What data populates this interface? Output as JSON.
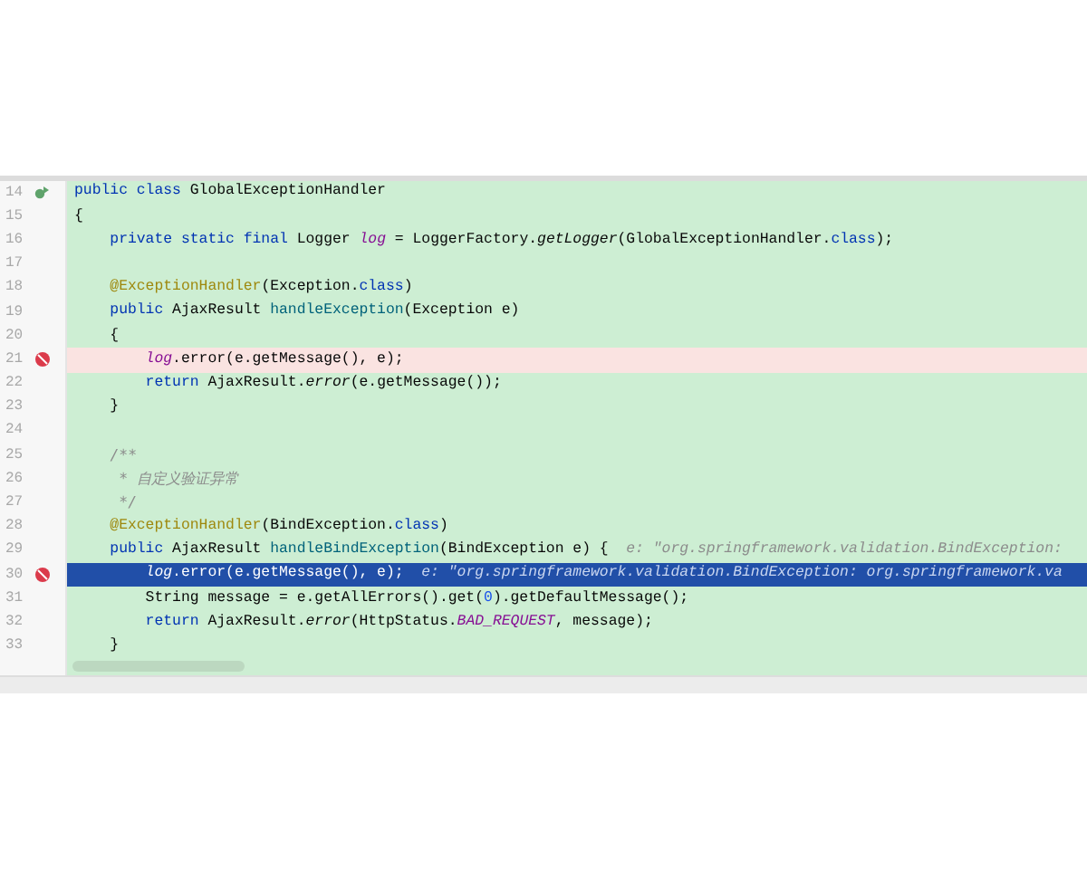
{
  "editor": {
    "lines": [
      {
        "number": "14",
        "implements": true,
        "breakpoint": false,
        "current": false,
        "tokens": [
          {
            "kind": "keyword",
            "t": "public class "
          },
          {
            "kind": "plain",
            "t": "GlobalExceptionHandler"
          }
        ]
      },
      {
        "number": "15",
        "implements": false,
        "breakpoint": false,
        "current": false,
        "tokens": [
          {
            "kind": "plain",
            "t": "{"
          }
        ]
      },
      {
        "number": "16",
        "implements": false,
        "breakpoint": false,
        "current": false,
        "tokens": [
          {
            "kind": "keyword",
            "t": "    private static final "
          },
          {
            "kind": "plain",
            "t": "Logger "
          },
          {
            "kind": "field",
            "t": "log"
          },
          {
            "kind": "plain",
            "t": " = LoggerFactory."
          },
          {
            "kind": "static",
            "t": "getLogger"
          },
          {
            "kind": "plain",
            "t": "(GlobalExceptionHandler."
          },
          {
            "kind": "keyword",
            "t": "class"
          },
          {
            "kind": "plain",
            "t": ");"
          }
        ]
      },
      {
        "number": "17",
        "implements": false,
        "breakpoint": false,
        "current": false
      },
      {
        "number": "18",
        "implements": false,
        "breakpoint": false,
        "current": false,
        "tokens": [
          {
            "kind": "annotation",
            "t": "    @ExceptionHandler"
          },
          {
            "kind": "plain",
            "t": "(Exception."
          },
          {
            "kind": "keyword",
            "t": "class"
          },
          {
            "kind": "plain",
            "t": ")"
          }
        ]
      },
      {
        "number": "19",
        "implements": false,
        "breakpoint": false,
        "current": false,
        "tokens": [
          {
            "kind": "keyword",
            "t": "    public "
          },
          {
            "kind": "plain",
            "t": "AjaxResult "
          },
          {
            "kind": "method",
            "t": "handleException"
          },
          {
            "kind": "plain",
            "t": "(Exception e)"
          }
        ]
      },
      {
        "number": "20",
        "implements": false,
        "breakpoint": false,
        "current": false,
        "tokens": [
          {
            "kind": "plain",
            "t": "    {"
          }
        ]
      },
      {
        "number": "21",
        "implements": false,
        "breakpoint": true,
        "current": false,
        "tokens": [
          {
            "kind": "field",
            "t": "        log"
          },
          {
            "kind": "plain",
            "t": ".error(e.getMessage(), e);"
          }
        ]
      },
      {
        "number": "22",
        "implements": false,
        "breakpoint": false,
        "current": false,
        "tokens": [
          {
            "kind": "keyword",
            "t": "        return "
          },
          {
            "kind": "plain",
            "t": "AjaxResult."
          },
          {
            "kind": "static",
            "t": "error"
          },
          {
            "kind": "plain",
            "t": "(e.getMessage());"
          }
        ]
      },
      {
        "number": "23",
        "implements": false,
        "breakpoint": false,
        "current": false,
        "tokens": [
          {
            "kind": "plain",
            "t": "    }"
          }
        ]
      },
      {
        "number": "24",
        "implements": false,
        "breakpoint": false,
        "current": false
      },
      {
        "number": "25",
        "implements": false,
        "breakpoint": false,
        "current": false,
        "tokens": [
          {
            "kind": "comment",
            "t": "    /**"
          }
        ]
      },
      {
        "number": "26",
        "implements": false,
        "breakpoint": false,
        "current": false,
        "tokens": [
          {
            "kind": "comment",
            "t": "     * 自定义验证异常"
          }
        ]
      },
      {
        "number": "27",
        "implements": false,
        "breakpoint": false,
        "current": false,
        "tokens": [
          {
            "kind": "comment",
            "t": "     */"
          }
        ]
      },
      {
        "number": "28",
        "implements": false,
        "breakpoint": false,
        "current": false,
        "tokens": [
          {
            "kind": "annotation",
            "t": "    @ExceptionHandler"
          },
          {
            "kind": "plain",
            "t": "(BindException."
          },
          {
            "kind": "keyword",
            "t": "class"
          },
          {
            "kind": "plain",
            "t": ")"
          }
        ]
      },
      {
        "number": "29",
        "implements": false,
        "breakpoint": false,
        "current": false,
        "tokens": [
          {
            "kind": "keyword",
            "t": "    public "
          },
          {
            "kind": "plain",
            "t": "AjaxResult "
          },
          {
            "kind": "method",
            "t": "handleBindException"
          },
          {
            "kind": "plain",
            "t": "(BindException e) {  "
          },
          {
            "kind": "hint",
            "t": "e: \"org.springframework.validation.BindException:"
          }
        ]
      },
      {
        "number": "30",
        "implements": false,
        "breakpoint": true,
        "current": true,
        "tokens": [
          {
            "kind": "field",
            "t": "        log"
          },
          {
            "kind": "plain",
            "t": ".error(e.getMessage(), e);  "
          },
          {
            "kind": "hint",
            "t": "e: \"org.springframework.validation.BindException: org.springframework.va"
          }
        ]
      },
      {
        "number": "31",
        "implements": false,
        "breakpoint": false,
        "current": false,
        "tokens": [
          {
            "kind": "plain",
            "t": "        String message = e.getAllErrors().get("
          },
          {
            "kind": "number",
            "t": "0"
          },
          {
            "kind": "plain",
            "t": ").getDefaultMessage();"
          }
        ]
      },
      {
        "number": "32",
        "implements": false,
        "breakpoint": false,
        "current": false,
        "tokens": [
          {
            "kind": "keyword",
            "t": "        return "
          },
          {
            "kind": "plain",
            "t": "AjaxResult."
          },
          {
            "kind": "static",
            "t": "error"
          },
          {
            "kind": "plain",
            "t": "(HttpStatus."
          },
          {
            "kind": "constant",
            "t": "BAD_REQUEST"
          },
          {
            "kind": "plain",
            "t": ", message);"
          }
        ]
      },
      {
        "number": "33",
        "implements": false,
        "breakpoint": false,
        "current": false,
        "tokens": [
          {
            "kind": "plain",
            "t": "    }"
          }
        ]
      }
    ]
  }
}
